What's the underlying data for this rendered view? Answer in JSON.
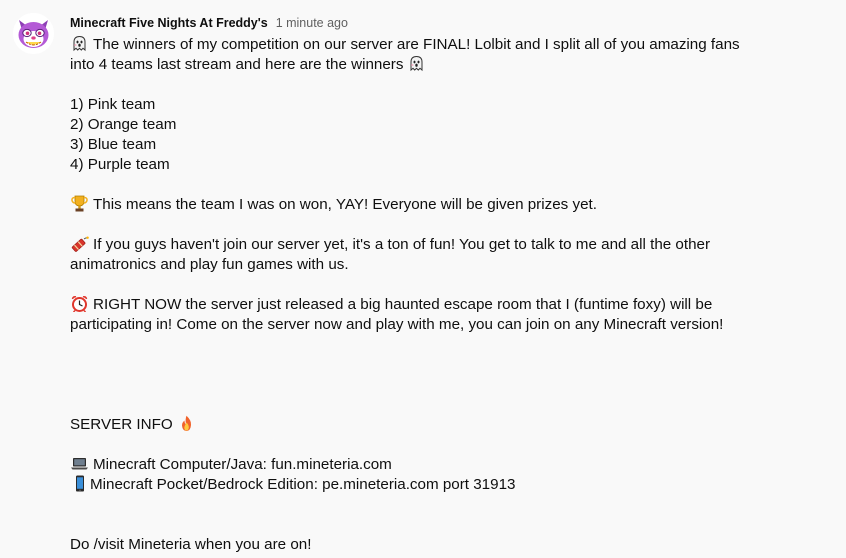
{
  "post": {
    "channel_name": "Minecraft Five Nights At Freddy's",
    "timestamp": "1 minute ago",
    "avatar_icon": "funtime-foxy-face-icon",
    "lines": [
      {
        "lead": "ghost-icon",
        "text": "The winners of my competition on our server are FINAL! Lolbit and I split all of you amazing fans"
      },
      {
        "text": "into 4 teams last stream and here are the winners",
        "trail": "ghost-icon"
      },
      {
        "text": ""
      },
      {
        "text": "1) Pink team"
      },
      {
        "text": "2) Orange team"
      },
      {
        "text": "3) Blue team"
      },
      {
        "text": "4) Purple team"
      },
      {
        "text": ""
      },
      {
        "lead": "trophy-icon",
        "text": "This means the team I was on won, YAY! Everyone will be given prizes yet."
      },
      {
        "text": ""
      },
      {
        "lead": "firecracker-icon",
        "text": "If you guys haven't join our server yet, it's a ton of fun! You get to talk to me and all the other"
      },
      {
        "text": "animatronics and play fun games with us."
      },
      {
        "text": ""
      },
      {
        "lead": "alarm-clock-icon",
        "text": "RIGHT NOW the server just released a big haunted escape room that I (funtime foxy) will be"
      },
      {
        "text": "participating in! Come on the server now and play with me, you can join on any Minecraft version!"
      },
      {
        "text": ""
      },
      {
        "text": ""
      },
      {
        "text": ""
      },
      {
        "text": ""
      },
      {
        "text": "SERVER INFO",
        "trail": "fire-icon"
      },
      {
        "text": ""
      },
      {
        "lead": "laptop-icon",
        "text": "Minecraft Computer/Java: fun.mineteria.com"
      },
      {
        "lead": "mobile-phone-icon",
        "text": "Minecraft Pocket/Bedrock Edition: pe.mineteria.com port 31913"
      },
      {
        "text": ""
      },
      {
        "text": ""
      },
      {
        "text": "Do /visit Mineteria when you are on!"
      },
      {
        "text": ""
      }
    ]
  }
}
